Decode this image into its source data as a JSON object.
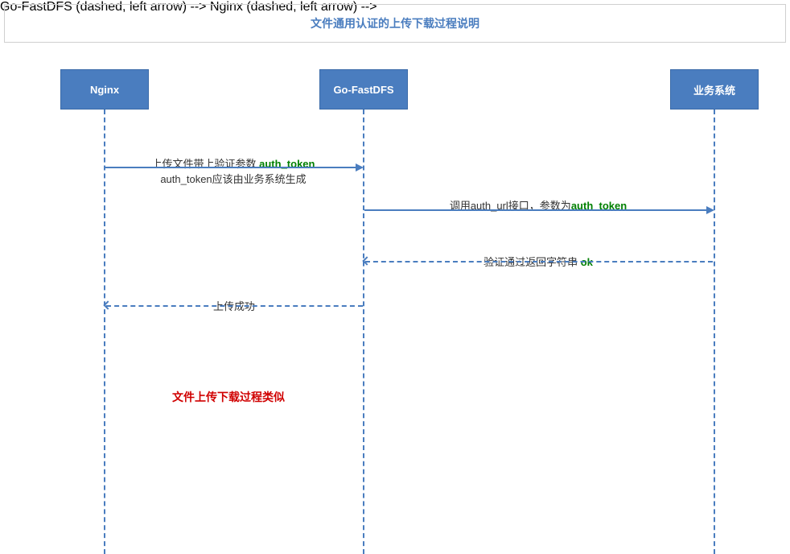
{
  "title": "文件通用认证的上传下载过程说明",
  "participants": {
    "p1": "Nginx",
    "p2": "Go-FastDFS",
    "p3": "业务系统"
  },
  "messages": {
    "m1_line1_pre": "上传文件带上验证参数 ",
    "m1_line1_hl": "auth_token",
    "m1_line2": "auth_token应该由业务系统生成",
    "m2_pre": "调用auth_url接口，参数为",
    "m2_hl": "auth_token",
    "m3_pre": "验证通过返回字符串 ",
    "m3_hl": "ok",
    "m4": "上传成功"
  },
  "note": "文件上传下载过程类似"
}
